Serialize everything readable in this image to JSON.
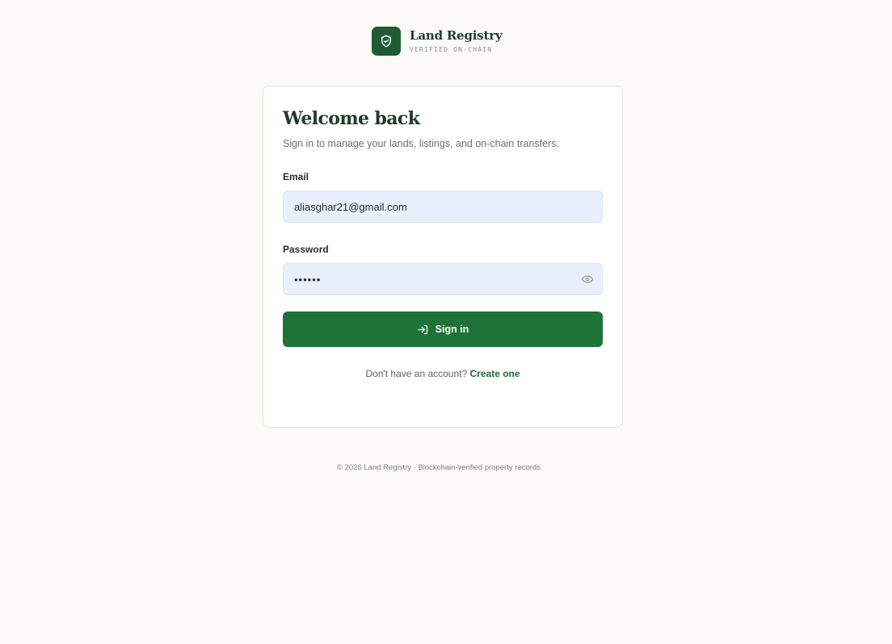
{
  "brand": {
    "title": "Land Registry",
    "subtitle": "VERIFIED ON-CHAIN",
    "icon": "shield-check-icon",
    "color": "#1e5b34"
  },
  "login": {
    "heading": "Welcome back",
    "subtitle": "Sign in to manage your lands, listings, and on-chain transfers.",
    "email_label": "Email",
    "email_value": "aliasghar21@gmail.com",
    "password_label": "Password",
    "password_value": "••••••",
    "password_toggle_icon": "eye-icon",
    "submit_label": "Sign in",
    "submit_icon": "sign-in-arrow-icon",
    "submit_color": "#1e7338",
    "signup_prompt": "Don't have an account?",
    "signup_link": "Create one"
  },
  "footer": {
    "text": "© 2026 Land Registry · Blockchain-verified property records"
  }
}
